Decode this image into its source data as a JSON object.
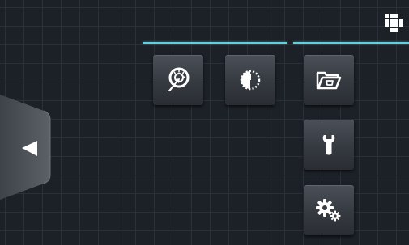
{
  "colors": {
    "background": "#1c2127",
    "grid": "#2a3038",
    "accent": "#5fd1de",
    "tile": "#3a3f46",
    "icon": "#ffffff"
  },
  "header": {
    "apps_icon": "grid-icon"
  },
  "group_dividers": [
    "left",
    "right"
  ],
  "tiles": [
    {
      "id": "dial",
      "icon": "gauge-pointer-icon"
    },
    {
      "id": "timer",
      "icon": "timer-icon"
    },
    {
      "id": "folder",
      "icon": "open-folder-icon"
    },
    {
      "id": "service",
      "icon": "wrench-icon"
    },
    {
      "id": "settings",
      "icon": "gears-icon"
    }
  ],
  "side_tab": {
    "icon": "triangle-left-icon"
  }
}
